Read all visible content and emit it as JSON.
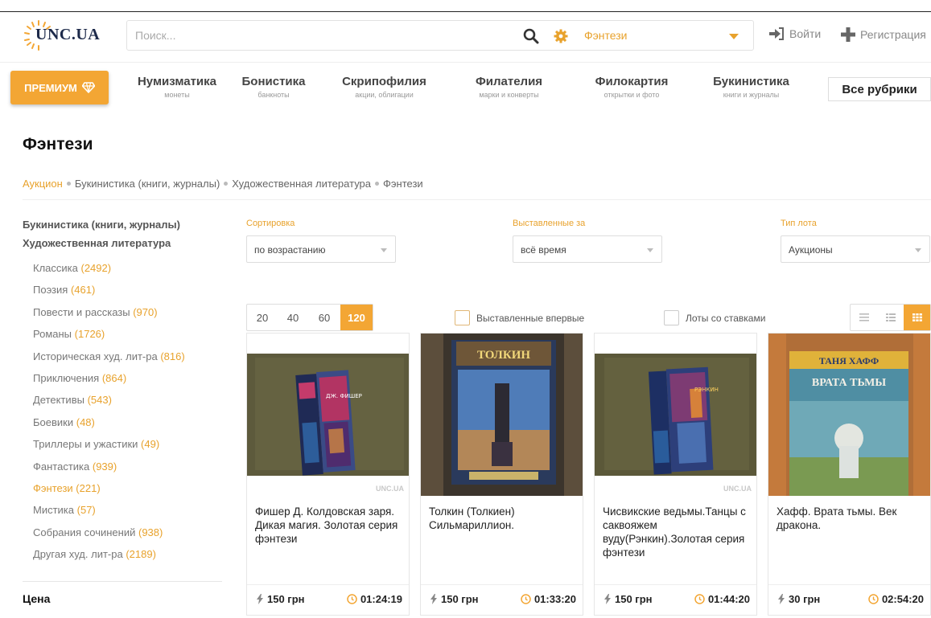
{
  "header": {
    "logo_text": "UNC.UA",
    "search_placeholder": "Поиск...",
    "category": "Фэнтези",
    "login": "Войти",
    "register": "Регистрация"
  },
  "nav": {
    "premium": "ПРЕМИУМ",
    "rubrics": [
      {
        "title": "Нумизматика",
        "sub": "монеты"
      },
      {
        "title": "Бонистика",
        "sub": "банкноты"
      },
      {
        "title": "Скрипофилия",
        "sub": "акции, облигации"
      },
      {
        "title": "Филателия",
        "sub": "марки и конверты"
      },
      {
        "title": "Филокартия",
        "sub": "открытки и фото"
      },
      {
        "title": "Букинистика",
        "sub": "книги и журналы"
      }
    ],
    "all_rubrics": "Все рубрики"
  },
  "page_title": "Фэнтези",
  "breadcrumbs": [
    "Аукцион",
    "Букинистика (книги, журналы)",
    "Художественная литература",
    "Фэнтези"
  ],
  "sidebar": {
    "head1": "Букинистика (книги, журналы)",
    "head2": "Художественная литература",
    "items": [
      {
        "label": "Классика",
        "count": "(2492)"
      },
      {
        "label": "Поэзия",
        "count": "(461)"
      },
      {
        "label": "Повести и рассказы",
        "count": "(970)"
      },
      {
        "label": "Романы",
        "count": "(1726)"
      },
      {
        "label": "Историческая худ. лит-ра",
        "count": "(816)"
      },
      {
        "label": "Приключения",
        "count": "(864)"
      },
      {
        "label": "Детективы",
        "count": "(543)"
      },
      {
        "label": "Боевики",
        "count": "(48)"
      },
      {
        "label": "Триллеры и ужастики",
        "count": "(49)"
      },
      {
        "label": "Фантастика",
        "count": "(939)"
      },
      {
        "label": "Фэнтези",
        "count": "(221)",
        "active": true
      },
      {
        "label": "Мистика",
        "count": "(57)"
      },
      {
        "label": "Собрания сочинений",
        "count": "(938)"
      },
      {
        "label": "Другая худ. лит-ра",
        "count": "(2189)"
      }
    ],
    "price_heading": "Цена"
  },
  "filters": {
    "sort_label": "Сортировка",
    "sort_value": "по возрастанию",
    "period_label": "Выставленные за",
    "period_value": "всё время",
    "type_label": "Тип лота",
    "type_value": "Аукционы",
    "per_page": [
      "20",
      "40",
      "60",
      "120"
    ],
    "per_page_selected": "120",
    "first_listed": "Выставленные впервые",
    "with_bids": "Лоты со ставками"
  },
  "lots": [
    {
      "name": "Фишер Д. Колдовская заря. Дикая магия. Золотая серия фэнтези",
      "price": "150 грн",
      "time": "01:24:19",
      "watermark": "UNC.UA"
    },
    {
      "name": "Толкин (Толкиен) Сильмариллион.",
      "price": "150 грн",
      "time": "01:33:20",
      "watermark": ""
    },
    {
      "name": "Чисвикские ведьмы.Танцы с саквояжем вуду(Рэнкин).Золотая серия фэнтези",
      "price": "150 грн",
      "time": "01:44:20",
      "watermark": "UNC.UA"
    },
    {
      "name": "Хафф. Врата тьмы. Век дракона.",
      "price": "30 грн",
      "time": "02:54:20",
      "watermark": ""
    }
  ],
  "book_cover_text": {
    "b1": "ДЖ. ФИШЕР",
    "b2": "ТОЛКИН",
    "b3": "РЭНКИН",
    "b4_author": "ТАНЯ ХАФФ",
    "b4_title": "ВРАТА ТЬМЫ"
  },
  "colors": {
    "accent": "#f3a634",
    "accent_text": "#e8a22c"
  },
  "icons": [
    "logo-rays-icon",
    "search-icon",
    "gear-icon",
    "login-icon",
    "plus-icon",
    "diamond-icon",
    "bolt-icon",
    "clock-icon",
    "list-view-icon",
    "compact-view-icon",
    "grid-view-icon"
  ]
}
